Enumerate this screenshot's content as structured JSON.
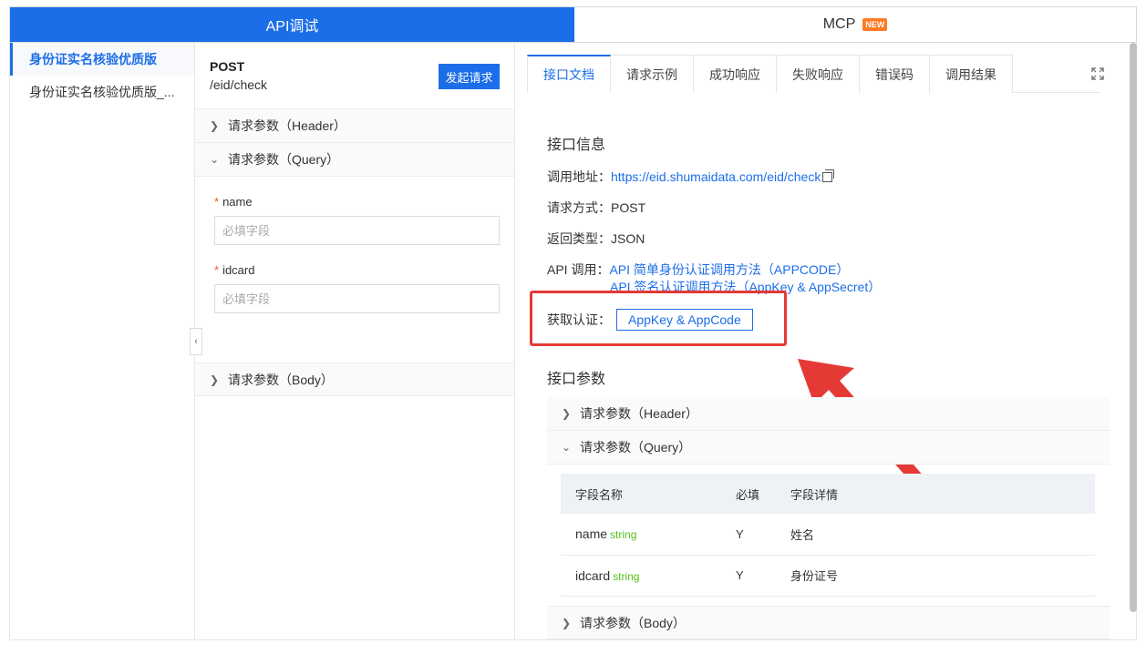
{
  "top_tabs": {
    "api_debug": "API调试",
    "mcp": "MCP",
    "mcp_badge": "NEW"
  },
  "sidebar": {
    "items": [
      {
        "label": "身份证实名核验优质版",
        "active": true
      },
      {
        "label": "身份证实名核验优质版_..."
      }
    ]
  },
  "request": {
    "method": "POST",
    "path": "/eid/check",
    "send_label": "发起请求",
    "header_section": "请求参数（Header）",
    "query_section": "请求参数（Query）",
    "body_section": "请求参数（Body）",
    "fields": [
      {
        "required_mark": "*",
        "name": "name",
        "placeholder": "必填字段"
      },
      {
        "required_mark": "*",
        "name": "idcard",
        "placeholder": "必填字段"
      }
    ]
  },
  "doc_tabs": [
    "接口文档",
    "请求示例",
    "成功响应",
    "失败响应",
    "错误码",
    "调用结果"
  ],
  "info": {
    "title": "接口信息",
    "url_label": "调用地址：",
    "url": "https://eid.shumaidata.com/eid/check",
    "method_label": "请求方式：",
    "method": "POST",
    "return_label": "返回类型：",
    "return_type": "JSON",
    "api_call_label": "API 调用：",
    "api_call_link1": "API 简单身份认证调用方法（APPCODE）",
    "api_call_link2": "API 签名认证调用方法（AppKey & AppSecret）",
    "auth_label": "获取认证：",
    "auth_button": "AppKey & AppCode"
  },
  "params": {
    "title": "接口参数",
    "header_section": "请求参数（Header）",
    "query_section": "请求参数（Query）",
    "body_section": "请求参数（Body）",
    "columns": [
      "字段名称",
      "必填",
      "字段详情"
    ],
    "rows": [
      {
        "name": "name",
        "type": "string",
        "required": "Y",
        "detail": "姓名"
      },
      {
        "name": "idcard",
        "type": "string",
        "required": "Y",
        "detail": "身份证号"
      }
    ]
  },
  "colors": {
    "primary": "#1c6ee8",
    "badge": "#ff7a22",
    "highlight": "#e53935",
    "type_green": "#52c41a"
  }
}
